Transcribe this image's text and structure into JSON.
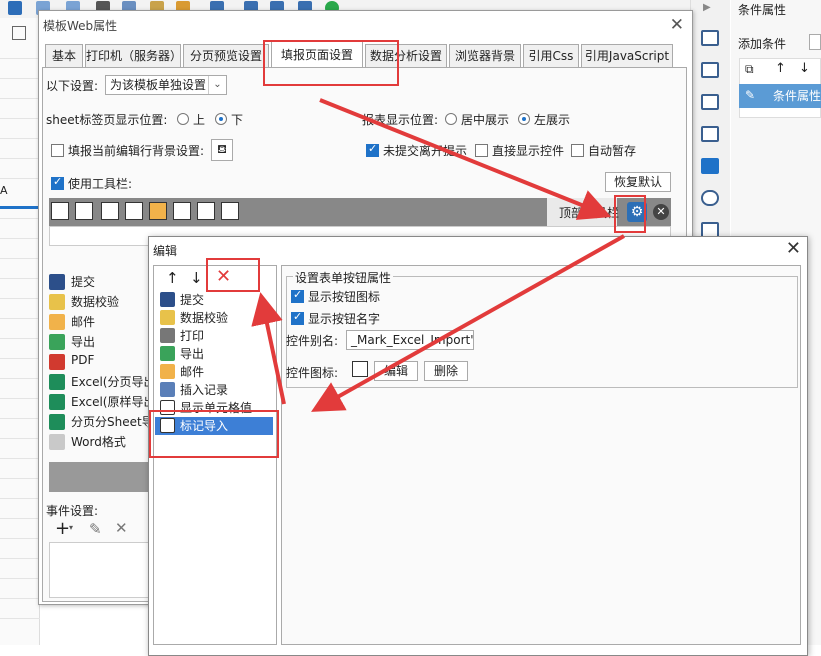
{
  "right_panel": {
    "title": "条件属性",
    "add_condition": "添加条件",
    "item": "条件属性"
  },
  "dialog1": {
    "title": "模板Web属性",
    "tabs": [
      "基本",
      "打印机（服务器）",
      "分页预览设置",
      "填报页面设置",
      "数据分析设置",
      "浏览器背景",
      "引用Css",
      "引用JavaScript"
    ],
    "active_tab": "填报页面设置",
    "settings_label": "以下设置:",
    "settings_value": "为该模板单独设置",
    "sheet_pos_label": "sheet标签页显示位置:",
    "sheet_pos_options": [
      "上",
      "下"
    ],
    "report_pos_label": "报表显示位置:",
    "report_pos_options": [
      "居中展示",
      "左展示"
    ],
    "fill_bg_label": "填报当前编辑行背景设置:",
    "unsubmitted_leave": "未提交离开提示",
    "direct_show": "直接显示控件",
    "auto_save": "自动暂存",
    "use_toolbar": "使用工具栏:",
    "restore_default": "恢复默认",
    "top_toolbar": "顶部工具栏",
    "button_list": [
      "提交",
      "数据校验",
      "邮件",
      "导出",
      "PDF",
      "Excel(分页导出",
      "Excel(原样导出",
      "分页分Sheet导出",
      "Word格式"
    ],
    "event_settings": "事件设置:"
  },
  "dialog2": {
    "title": "编辑",
    "items": [
      "提交",
      "数据校验",
      "打印",
      "导出",
      "邮件",
      "插入记录",
      "显示单元格值",
      "标记导入"
    ],
    "selected_item": "标记导入",
    "legend": "设置表单按钮属性",
    "show_icon": "显示按钮图标",
    "show_name": "显示按钮名字",
    "alias_label": "控件别名:",
    "alias_value": "_Mark_Excel_Import')}",
    "icon_label": "控件图标:",
    "edit_btn": "编辑",
    "delete_btn": "删除"
  },
  "colors": {
    "highlight": "#e23b3b",
    "accent": "#1f72c8",
    "selected": "#3d7fd6"
  }
}
